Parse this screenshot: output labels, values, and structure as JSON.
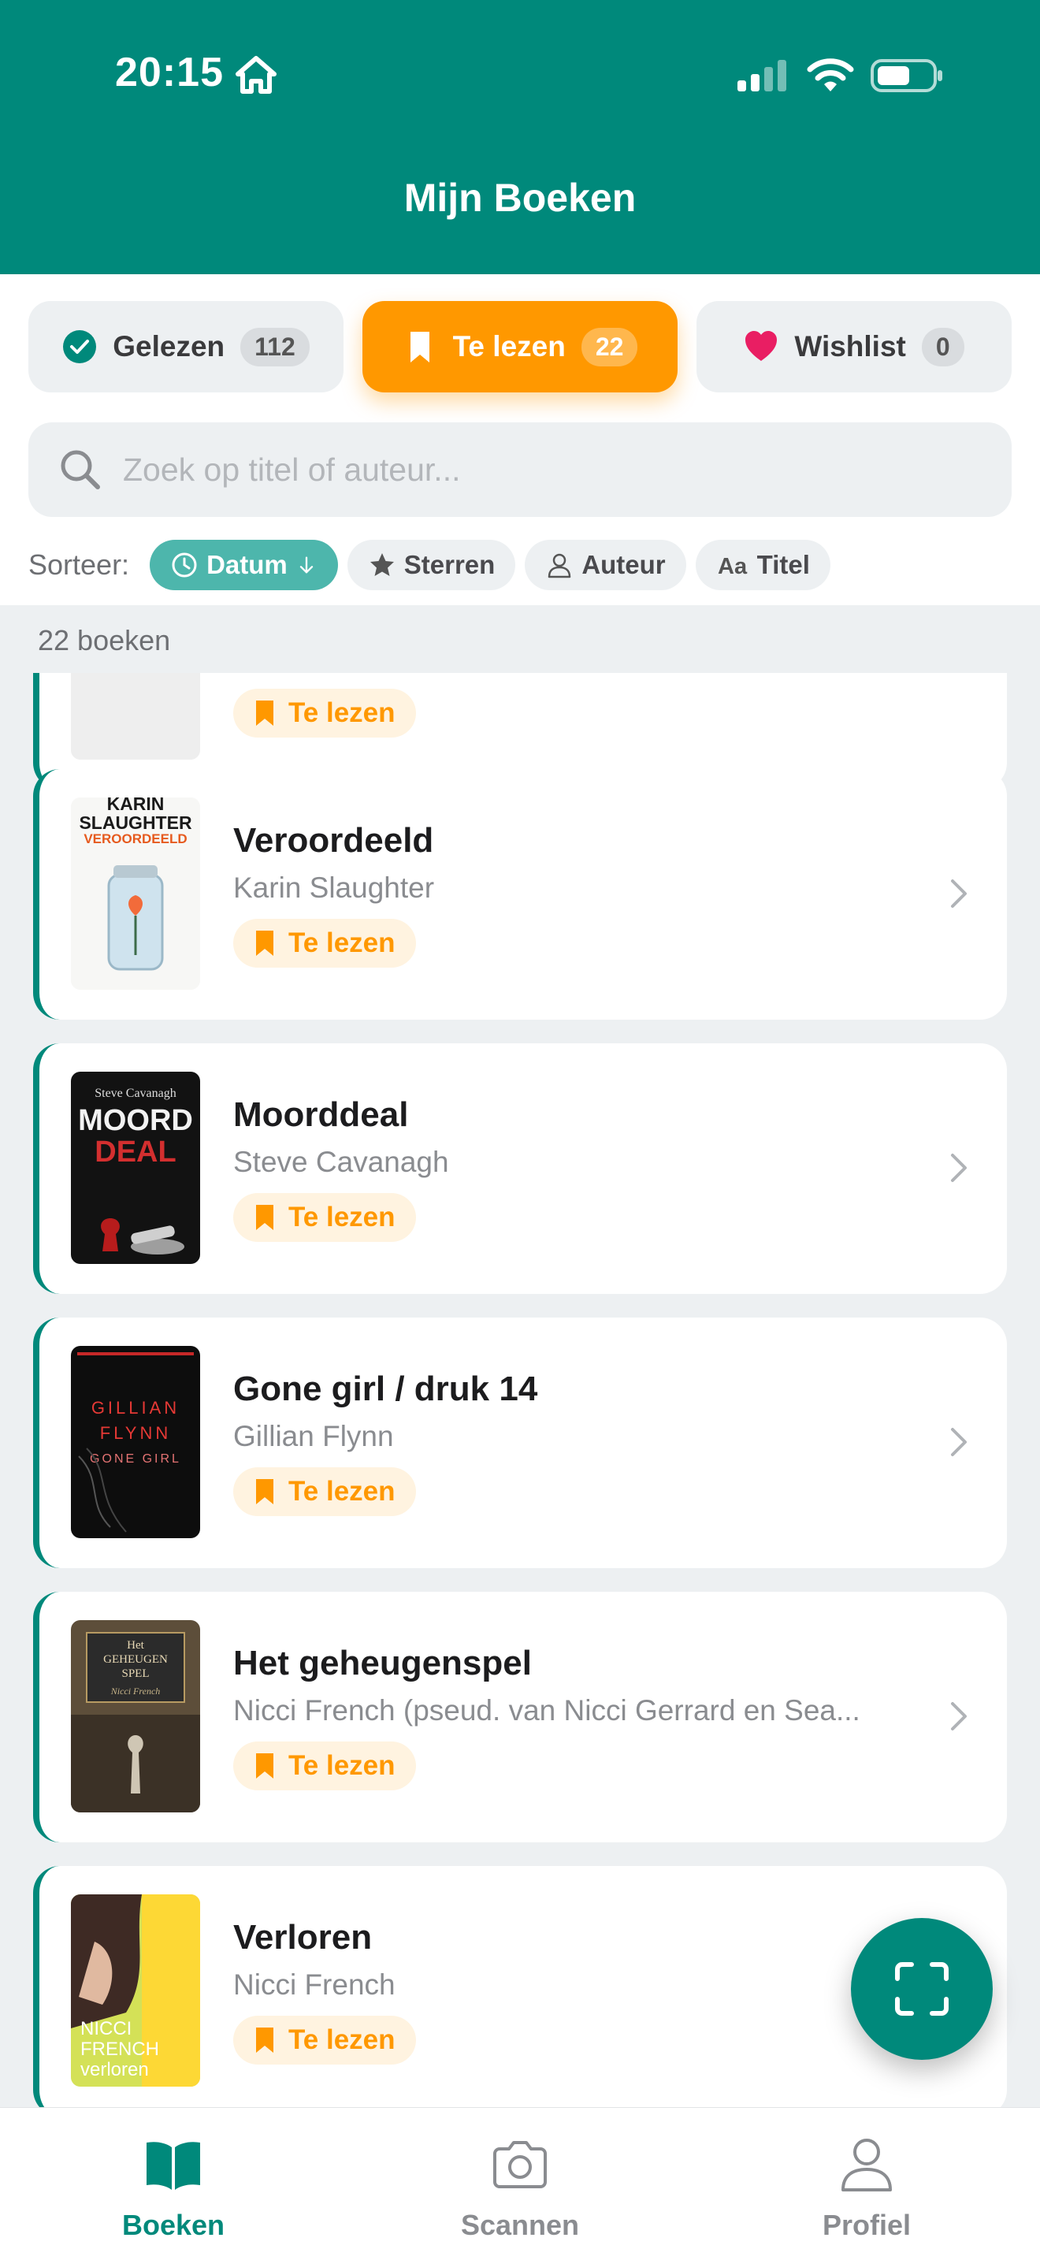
{
  "status_bar": {
    "time": "20:15"
  },
  "header": {
    "title": "Mijn Boeken"
  },
  "tabs": [
    {
      "label": "Gelezen",
      "count": "112",
      "icon": "check-circle-icon",
      "active": false
    },
    {
      "label": "Te lezen",
      "count": "22",
      "icon": "bookmark-icon",
      "active": true
    },
    {
      "label": "Wishlist",
      "count": "0",
      "icon": "heart-icon",
      "active": false
    }
  ],
  "search": {
    "placeholder": "Zoek op titel of auteur..."
  },
  "sort": {
    "label": "Sorteer:",
    "options": [
      {
        "label": "Datum",
        "icon": "clock-icon",
        "active": true
      },
      {
        "label": "Sterren",
        "icon": "star-icon",
        "active": false
      },
      {
        "label": "Auteur",
        "icon": "person-icon",
        "active": false
      },
      {
        "label": "Titel",
        "icon": "text-aa-icon",
        "active": false
      }
    ]
  },
  "list": {
    "count_label": "22 boeken",
    "books": [
      {
        "title": "",
        "author": "",
        "status": "Te lezen"
      },
      {
        "title": "Veroordeeld",
        "author": "Karin Slaughter",
        "status": "Te lezen",
        "cover_text": [
          "KARIN",
          "SLAUGHTER",
          "VEROORDEELD"
        ]
      },
      {
        "title": "Moorddeal",
        "author": "Steve Cavanagh",
        "status": "Te lezen",
        "cover_text": [
          "Steve Cavanagh",
          "MOORD",
          "DEAL"
        ]
      },
      {
        "title": "Gone girl / druk 14",
        "author": "Gillian Flynn",
        "status": "Te lezen",
        "cover_text": [
          "GILLIAN",
          "FLYNN",
          "GONE GIRL"
        ]
      },
      {
        "title": "Het geheugenspel",
        "author": "Nicci French (pseud. van Nicci Gerrard en Sea...",
        "status": "Te lezen",
        "cover_text": [
          "Het",
          "GEHEUGEN",
          "SPEL",
          "Nicci French"
        ]
      },
      {
        "title": "Verloren",
        "author": "Nicci French",
        "status": "Te lezen",
        "cover_text": [
          "NICCI",
          "FRENCH",
          "verloren"
        ]
      }
    ]
  },
  "colors": {
    "primary": "#00897b",
    "accent": "#ff9800",
    "chip_active": "#4db6ac",
    "background": "#edf0f2"
  },
  "fab": {
    "icon": "scan-frame-icon"
  },
  "bottom_nav": [
    {
      "label": "Boeken",
      "icon": "book-open-icon",
      "active": true
    },
    {
      "label": "Scannen",
      "icon": "camera-icon",
      "active": false
    },
    {
      "label": "Profiel",
      "icon": "person-icon",
      "active": false
    }
  ]
}
